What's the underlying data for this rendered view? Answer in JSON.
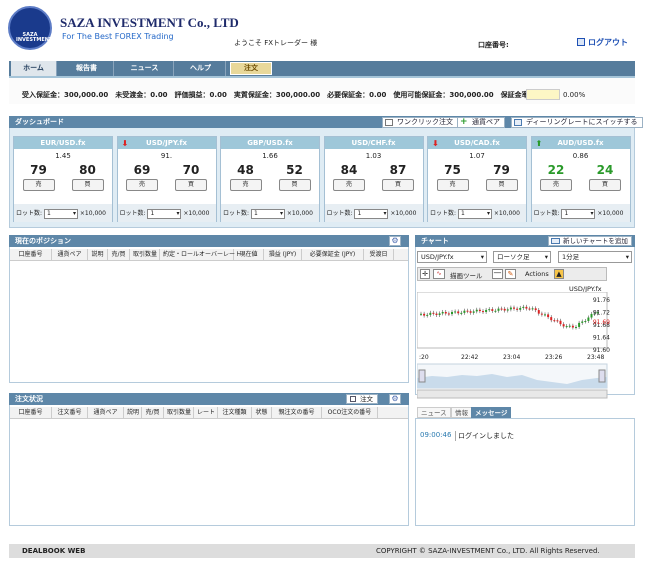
{
  "logo": {
    "arc_text": "For The Best Forex Trading",
    "badge": "SAZA INVESTMENT"
  },
  "header": {
    "brand": "SAZA INVESTMENT Co., LTD",
    "tagline": "For The Best FOREX Trading",
    "welcome": "ようこそ FXトレーダー 様",
    "account_label": "口座番号:",
    "logout": "ログアウト"
  },
  "nav": {
    "tabs": [
      "ホーム",
      "報告書",
      "ニュース",
      "ヘルプ",
      "注文"
    ]
  },
  "status": {
    "line": "受入保証金：300,000.00　未受渡金：0.00　評価損益：0.00　実質保証金：300,000.00　必要保証金：0.00　使用可能保証金：300,000.00　保証金率",
    "ratio": "0.00%"
  },
  "dashboard": {
    "title": "ダッシュボード",
    "one_click": "ワンクリック注文",
    "add_pair": "通貨ペア",
    "switch_rate": "ディーリングレートにスイッチする",
    "cards": [
      {
        "pair": "EUR/USD.fx",
        "dir": "",
        "rate": "1.45",
        "bid": "79",
        "ask": "80",
        "color": "#222"
      },
      {
        "pair": "USD/JPY.fx",
        "dir": "down",
        "rate": "91.",
        "bid": "69",
        "ask": "70",
        "color": "#222"
      },
      {
        "pair": "GBP/USD.fx",
        "dir": "",
        "rate": "1.66",
        "bid": "48",
        "ask": "52",
        "color": "#222"
      },
      {
        "pair": "USD/CHF.fx",
        "dir": "",
        "rate": "1.03",
        "bid": "84",
        "ask": "87",
        "color": "#222"
      },
      {
        "pair": "USD/CAD.fx",
        "dir": "down",
        "rate": "1.07",
        "bid": "75",
        "ask": "79",
        "color": "#222"
      },
      {
        "pair": "AUD/USD.fx",
        "dir": "up",
        "rate": "0.86",
        "bid": "22",
        "ask": "24",
        "color": "#2a9a2a"
      }
    ],
    "sell": "売",
    "buy": "買",
    "lot_label": "ロット数:",
    "lot_value": "1",
    "lot_unit": "×10,000"
  },
  "positions": {
    "title": "現在のポジション",
    "columns": [
      "口座番号",
      "通貨ペア",
      "説明",
      "売/買",
      "取引数量",
      "約定・ロールオーバーレート",
      "現在値",
      "損益 (JPY)",
      "必要保証金 (JPY)",
      "受渡日"
    ]
  },
  "orders": {
    "title": "注文状況",
    "order_btn": "注文",
    "columns": [
      "口座番号",
      "注文番号",
      "通貨ペア",
      "説明",
      "売/買",
      "取引数量",
      "レート",
      "注文種類",
      "状態",
      "親注文の番号",
      "OCO注文の番号"
    ]
  },
  "chart": {
    "title": "チャート",
    "new_chart": "新しいチャートを追加",
    "pair": "USD/JPY.fx",
    "candle": "ローソク足",
    "interval": "1分足",
    "draw_tools": "描画ツール",
    "actions": "Actions",
    "symbol": "USD/JPY.fx",
    "y_ticks": [
      "91.76",
      "91.72",
      "91.68",
      "91.64",
      "91.60"
    ],
    "last": "91.69",
    "x_ticks": [
      ":20",
      "22:42",
      "23:04",
      "23:26",
      "23:48"
    ]
  },
  "news": {
    "tabs": [
      "ニュース",
      "情報",
      "メッセージ"
    ],
    "time": "09:00:46",
    "message": "ログインしました"
  },
  "footer": {
    "left": "DEALBOOK WEB",
    "right": "COPYRIGHT © SAZA-INVESTMENT Co., LTD. All Rights Reserved."
  }
}
